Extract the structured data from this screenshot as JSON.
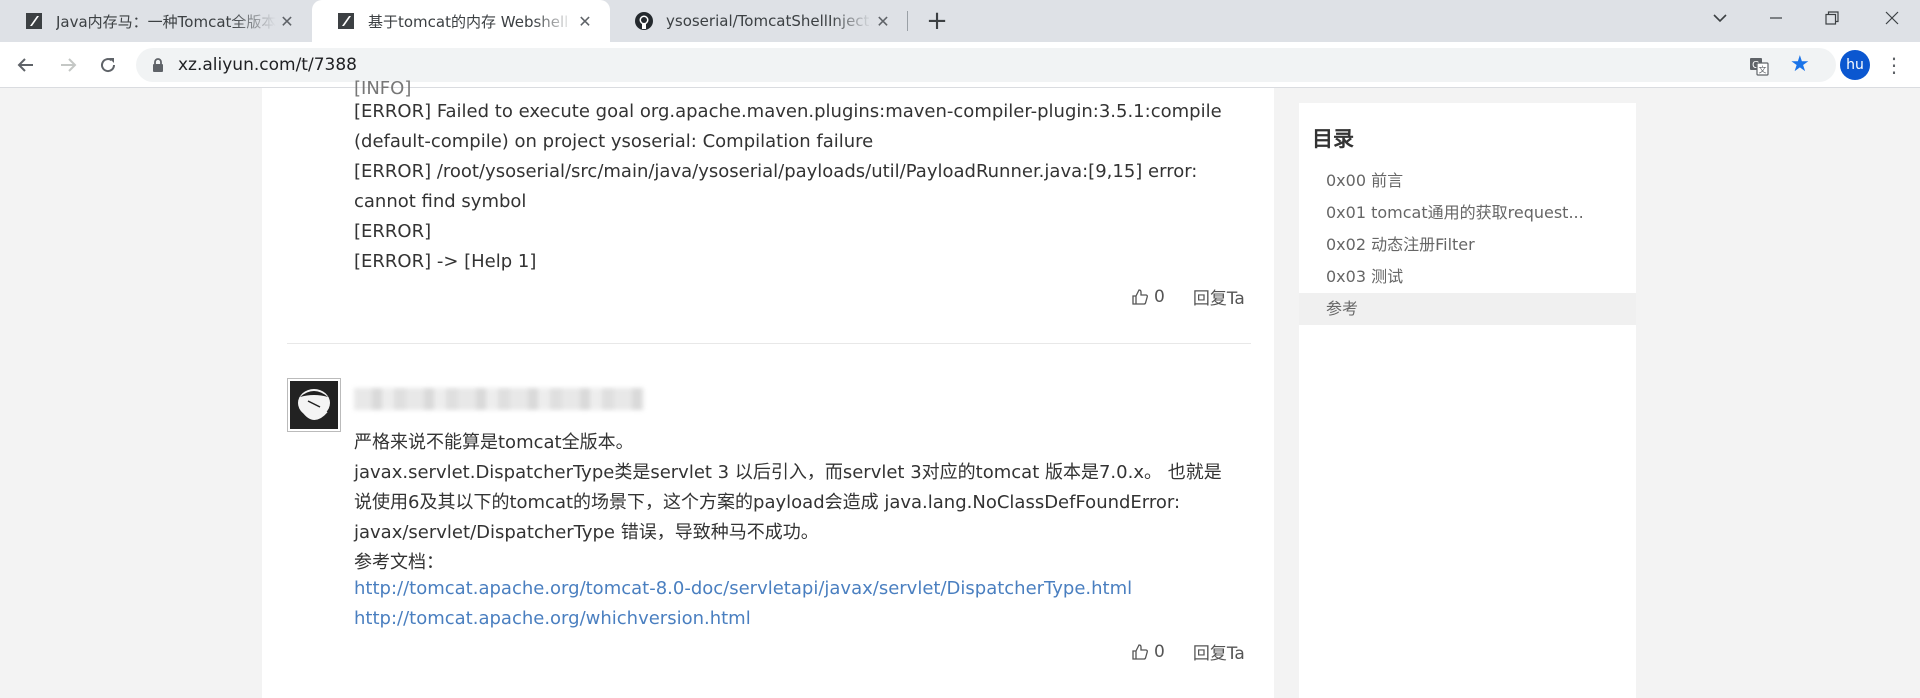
{
  "browser": {
    "tabs": [
      {
        "title": "Java内存马：一种Tomcat全版本获取StandardContext的新方法",
        "active": false
      },
      {
        "title": "基于tomcat的内存 Webshell 无文件攻击技术",
        "active": true
      },
      {
        "title": "ysoserial/TomcatShellInject.java",
        "active": false
      }
    ],
    "url": "xz.aliyun.com/t/7388",
    "profile_initials": "hu",
    "accent_color": "#1a73e8"
  },
  "article": {
    "code_lines": [
      "[ERROR] Failed to execute goal org.apache.maven.plugins:maven-compiler-plugin:3.5.1:compile",
      "(default-compile) on project ysoserial: Compilation failure",
      "[ERROR] /root/ysoserial/src/main/java/ysoserial/payloads/util/PayloadRunner.java:[9,15] error:",
      "cannot find symbol",
      "[ERROR]",
      "[ERROR] -> [Help 1]"
    ],
    "comment1_actions": {
      "like_count": "0",
      "reply_label": "回复Ta"
    },
    "comment2": {
      "lines": [
        "严格来说不能算是tomcat全版本。",
        "javax.servlet.DispatcherType类是servlet 3 以后引入，而servlet 3对应的tomcat 版本是7.0.x。 也就是",
        "说使用6及其以下的tomcat的场景下，这个方案的payload会造成 java.lang.NoClassDefFoundError:",
        "javax/servlet/DispatcherType 错误，导致种马不成功。",
        "参考文档："
      ],
      "links": [
        "http://tomcat.apache.org/tomcat-8.0-doc/servletapi/javax/servlet/DispatcherType.html",
        "http://tomcat.apache.org/whichversion.html"
      ],
      "like_count": "0",
      "reply_label": "回复Ta"
    }
  },
  "toc": {
    "title": "目录",
    "items": [
      {
        "label": "0x00 前言",
        "active": false
      },
      {
        "label": "0x01 tomcat通用的获取request...",
        "active": false
      },
      {
        "label": "0x02 动态注册Filter",
        "active": false
      },
      {
        "label": "0x03 测试",
        "active": false
      },
      {
        "label": "参考",
        "active": true
      }
    ]
  },
  "icons": {
    "tab_favicon_1": "xz-logo-icon",
    "tab_favicon_2": "xz-logo-icon",
    "tab_favicon_3": "github-icon",
    "like": "thumbs-up-icon",
    "new_tab": "plus-icon"
  }
}
